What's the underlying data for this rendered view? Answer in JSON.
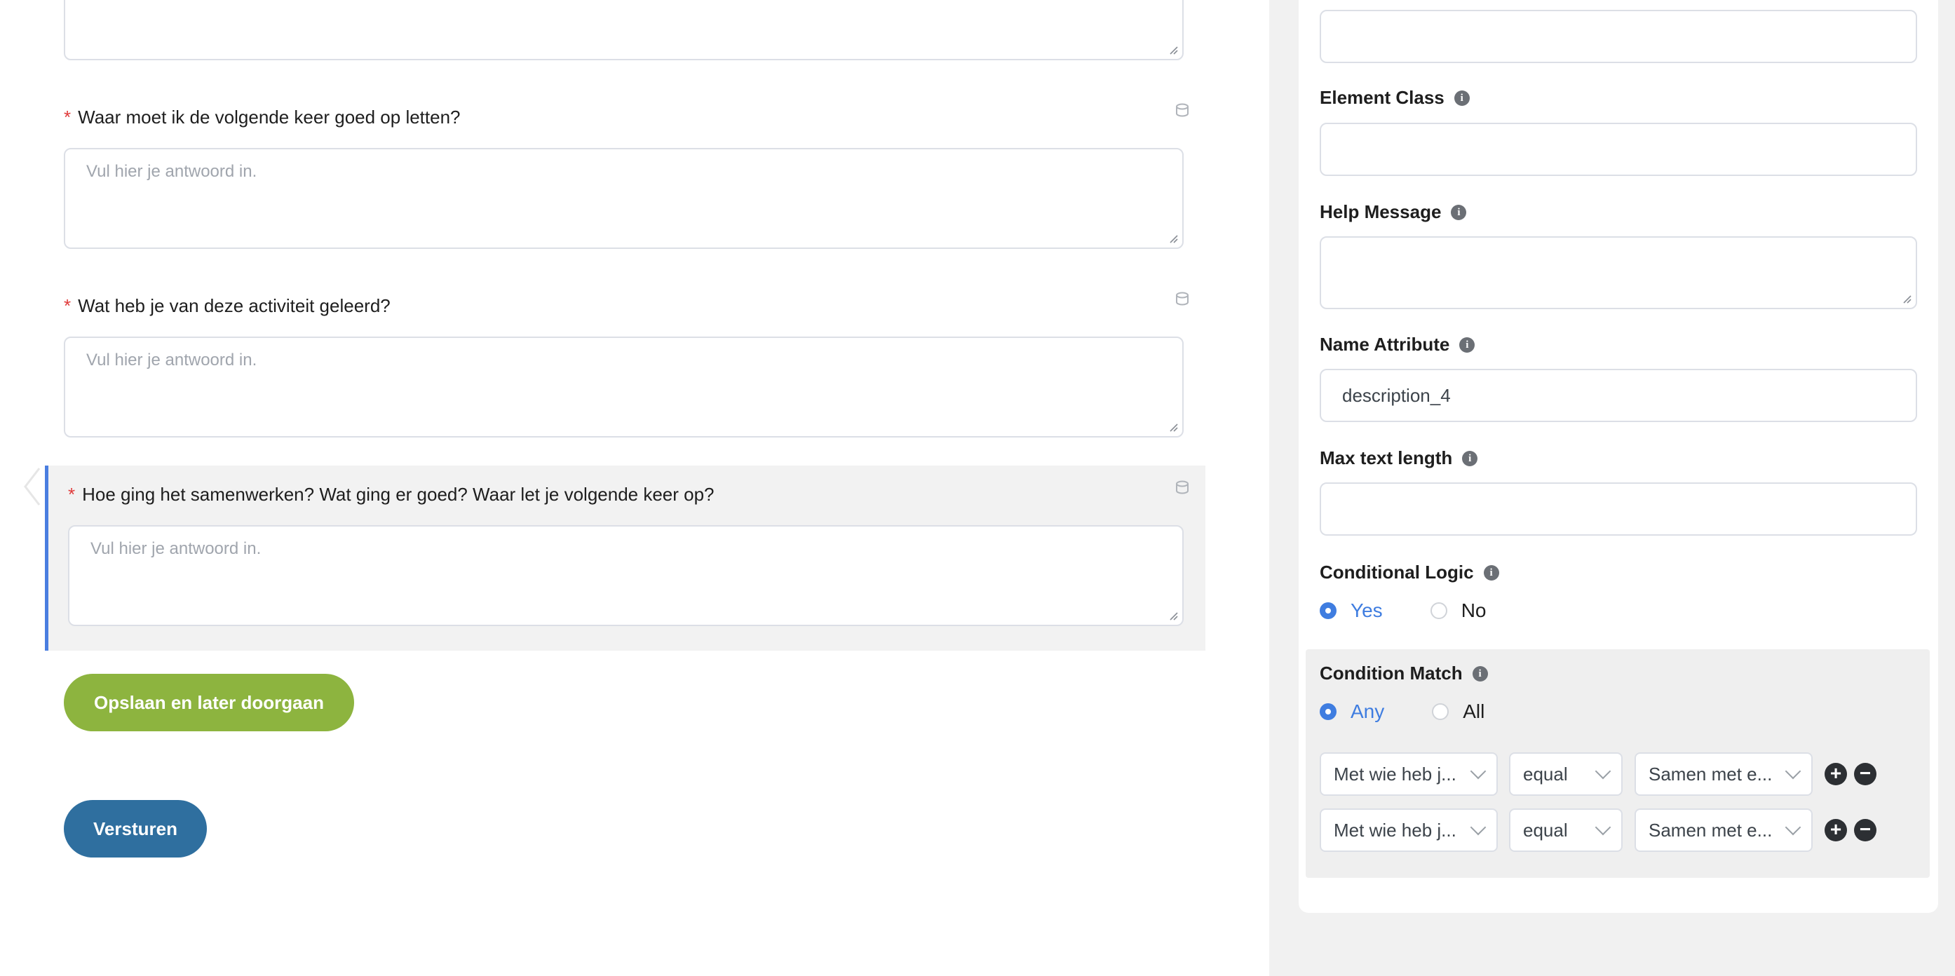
{
  "form": {
    "questions": [
      {
        "label": "Waar moet ik de volgende keer goed op letten?",
        "placeholder": "Vul hier je antwoord in."
      },
      {
        "label": "Wat heb je van deze activiteit geleerd?",
        "placeholder": "Vul hier je antwoord in."
      },
      {
        "label": "Hoe ging het samenwerken? Wat ging er goed? Waar let je volgende keer op?",
        "placeholder": "Vul hier je antwoord in."
      }
    ],
    "required_mark": "*",
    "save_later_label": "Opslaan en later doorgaan",
    "submit_label": "Versturen"
  },
  "settings": {
    "element_class_label": "Element Class",
    "help_message_label": "Help Message",
    "name_attribute_label": "Name Attribute",
    "name_attribute_value": "description_4",
    "max_text_length_label": "Max text length",
    "conditional_logic_label": "Conditional Logic",
    "conditional_logic_yes": "Yes",
    "conditional_logic_no": "No",
    "condition_match_label": "Condition Match",
    "condition_match_any": "Any",
    "condition_match_all": "All",
    "conditions": [
      {
        "field": "Met wie heb j...",
        "operator": "equal",
        "value": "Samen met e..."
      },
      {
        "field": "Met wie heb j...",
        "operator": "equal",
        "value": "Samen met e..."
      }
    ]
  },
  "colors": {
    "accent_blue": "#3f7de0",
    "save_green": "#8db43f",
    "submit_blue": "#2f6f9f",
    "required_red": "#e03b3b"
  }
}
